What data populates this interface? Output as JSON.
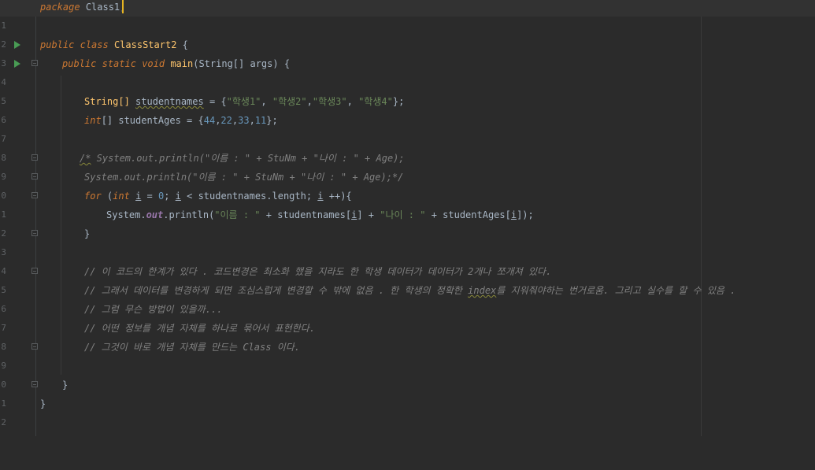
{
  "editor": {
    "line_numbers": [
      "1",
      "2",
      "3",
      "4",
      "5",
      "6",
      "7",
      "8",
      "9",
      "0",
      "1",
      "2",
      "3",
      "4",
      "5",
      "6",
      "7",
      "8",
      "9",
      "0",
      "1",
      "2"
    ],
    "package_kw": "package",
    "package_name": "Class1;",
    "l3_kw1": "public",
    "l3_kw2": "class",
    "class_name": "ClassStart2",
    "l3_brace": " {",
    "l4_kw1": "public",
    "l4_kw2": "static",
    "l4_kw3": "void",
    "method_name": "main",
    "l4_rest": "(String[] args) {",
    "l6_type": "String[] ",
    "l6_var": "studentnames",
    "l6_eq": " = {",
    "l6_s1": "\"학생1\"",
    "l6_c1": ", ",
    "l6_s2": "\"학생2\"",
    "l6_c2": ",",
    "l6_s3": "\"학생3\"",
    "l6_c3": ", ",
    "l6_s4": "\"학생4\"",
    "l6_end": "};",
    "l7_type": "int",
    "l7_rest": "[] studentAges = {",
    "l7_n1": "44",
    "l7_n2": "22",
    "l7_n3": "33",
    "l7_n4": "11",
    "comma": ",",
    "l7_end": "};",
    "l9_start": "/*",
    "l9_rest": " System.out.println(\"이름 : \" + StuNm + \"나이 : \" + Age);",
    "l10": "System.out.println(\"이름 : \" + StuNm + \"나이 : \" + Age);*/",
    "l11_for": "for",
    "l11_p": " (",
    "l11_int": "int",
    "l11_i": "i",
    "l11_eq": " = ",
    "l11_zero": "0",
    "l11_semi": "; ",
    "l11_i2": "i",
    "l11_lt": " < studentnames.length; ",
    "l11_i3": "i",
    "l11_end": " ++){",
    "l12_sys": "System.",
    "l12_out": "out",
    "l12_pr": ".println(",
    "l12_s1": "\"이름 : \"",
    "l12_plus1": " + studentnames[",
    "l12_i": "i",
    "l12_b1": "] + ",
    "l12_s2": "\"나이 : \"",
    "l12_plus2": " + studentAges[",
    "l12_i2": "i",
    "l12_end": "]);",
    "l13": "}",
    "c1": "// 이 코드의 한계가 있다 . 코드변경은 최소화 했을 지라도 한 학생 데이터가 데이터가 2개나 쪼개져 있다.",
    "c2a": "// 그래서 데이터를 변경하게 되면 조심스럽게 변경할 수 밖에 없음 . 한 학생의 정확한 ",
    "c2b": "index",
    "c2c": "를 지워줘야하는 번거로움. 그리고 실수를 할 수 있음 .",
    "c3": "// 그럼 무슨 방법이 있을까...",
    "c4": "// 어떤 정보를 개념 자체를 하나로 묶어서 표현한다.",
    "c5": "// 그것이 바로 개념 자체를 만드는 Class 이다.",
    "l21": "}",
    "l22": "}"
  }
}
